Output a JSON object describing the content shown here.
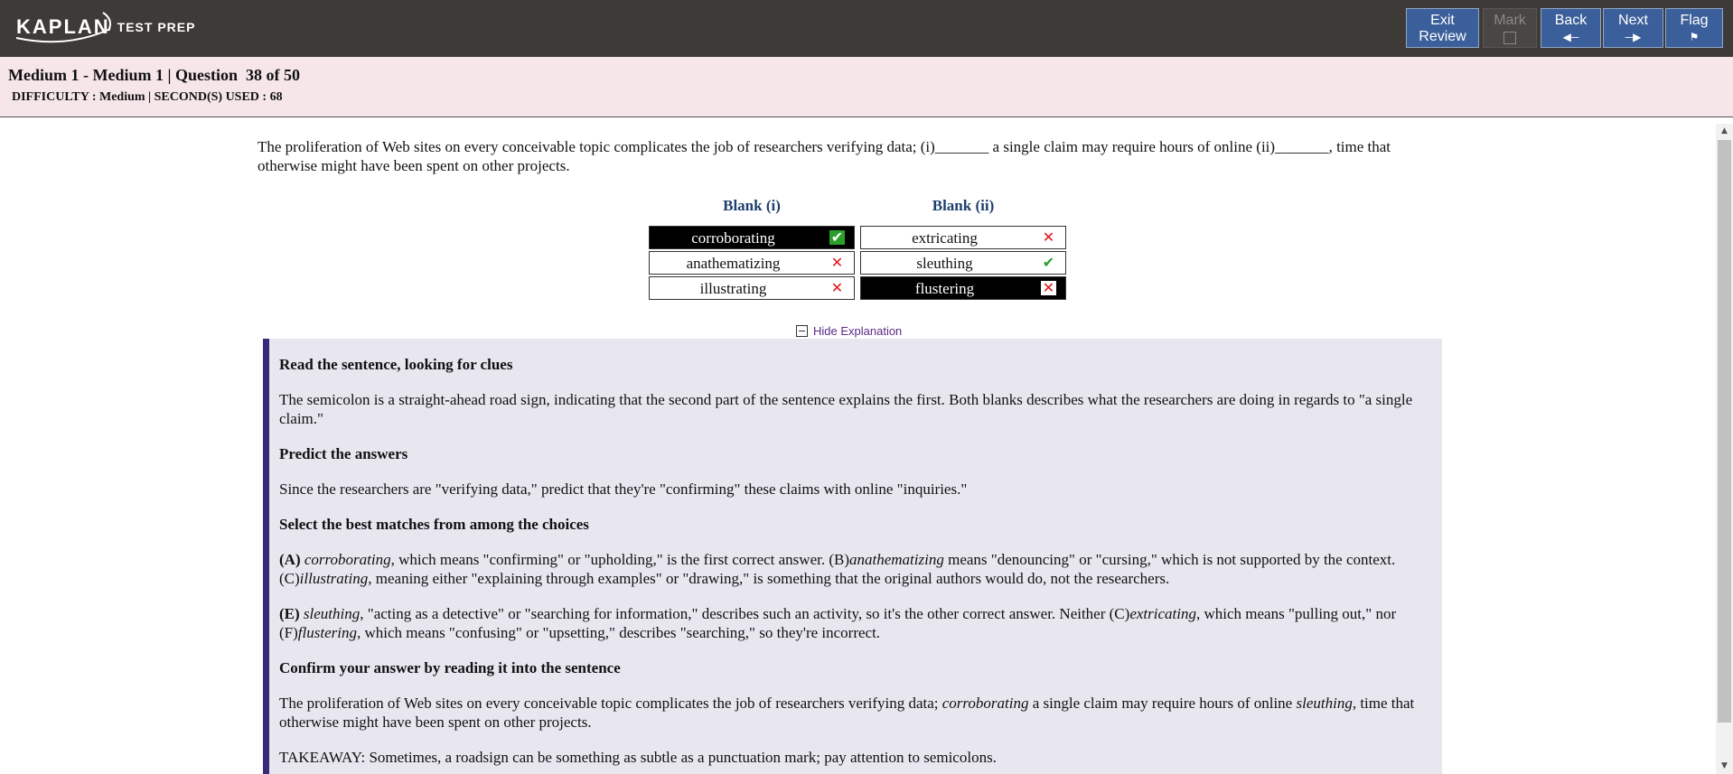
{
  "header": {
    "logo_main": "KAPLAN",
    "logo_sub": "TEST PREP",
    "buttons": {
      "exit_review": [
        "Exit",
        "Review"
      ],
      "mark": "Mark",
      "back": "Back",
      "next": "Next",
      "flag": "Flag"
    }
  },
  "info": {
    "title": "Medium 1 - Medium 1 | Question  38 of 50",
    "meta": "DIFFICULTY : Medium | SECOND(S) USED : 68"
  },
  "question": {
    "stem": "The proliferation of Web sites on every conceivable topic complicates the job of researchers verifying data; (i)_______ a single claim may require hours of online (ii)_______, time that otherwise might have been spent on other projects.",
    "blank1": {
      "header": "Blank (i)",
      "choices": [
        "corroborating",
        "anathematizing",
        "illustrating"
      ]
    },
    "blank2": {
      "header": "Blank (ii)",
      "choices": [
        "extricating",
        "sleuthing",
        "flustering"
      ]
    }
  },
  "explanation": {
    "toggle_label": "Hide Explanation",
    "h1": "Read the sentence, looking for clues",
    "p1": "The semicolon is a straight-ahead road sign, indicating that the second part of the sentence explains the first. Both blanks describes what the researchers are doing in regards to \"a single claim.\"",
    "h2": "Predict the answers",
    "p2": "Since the researchers are \"verifying data,\" predict that they're \"confirming\" these claims with online \"inquiries.\"",
    "h3": "Select the best matches from among the choices",
    "p3": {
      "label": "(A)",
      "w1": "corroborating",
      "t1": ", which means \"confirming\" or \"upholding,\" is the first correct answer. (B)",
      "w2": "anathematizing",
      "t2": " means \"denouncing\" or \"cursing,\" which is not supported by the context. (C)",
      "w3": "illustrating",
      "t3": ", meaning either \"explaining through examples\" or \"drawing,\" is something that the original authors would do, not the researchers."
    },
    "p4": {
      "label": "(E)",
      "w1": "sleuthing",
      "t1": ", \"acting as a detective\" or \"searching for information,\" describes such an activity, so it's the other correct answer. Neither (C)",
      "w2": "extricating",
      "t2": ", which means \"pulling out,\" nor (F)",
      "w3": "flustering",
      "t3": ", which means \"confusing\" or \"upsetting,\" describes \"searching,\" so they're incorrect."
    },
    "h4": "Confirm your answer by reading it into the sentence",
    "p5": {
      "t1": "The proliferation of Web sites on every conceivable topic complicates the job of researchers verifying data; ",
      "w1": "corroborating",
      "t2": " a single claim may require hours of online ",
      "w2": "sleuthing",
      "t3": ", time that otherwise might have been spent on other projects."
    },
    "takeaway": "TAKEAWAY: Sometimes, a roadsign can be something as subtle as a punctuation mark; pay attention to semicolons."
  }
}
